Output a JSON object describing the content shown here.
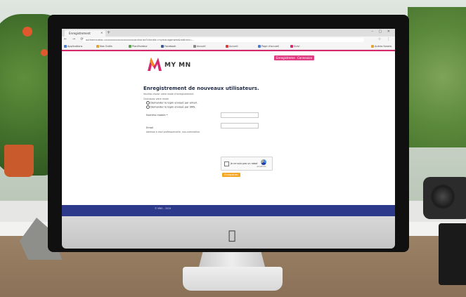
{
  "browser": {
    "tab_title": "Enregistrement",
    "url": "authentication.xxxxxxxxxxxxxxxxxxxx/authorize?clientId=mymanagerweb&redirect=...",
    "bookmarks": [
      {
        "label": "Applications",
        "color": "#4a7bd0"
      },
      {
        "label": "Nos Outils",
        "color": "#e0a33a"
      },
      {
        "label": "Planificateur",
        "color": "#59a14f"
      },
      {
        "label": "Facebook",
        "color": "#3b5998"
      },
      {
        "label": "Accueil",
        "color": "#888888"
      },
      {
        "label": "Accueil",
        "color": "#d93a3a"
      },
      {
        "label": "Page d'accueil",
        "color": "#4a7bd0"
      },
      {
        "label": "Suivi",
        "color": "#d6266d"
      },
      {
        "label": "Autres favoris",
        "color": "#e0a33a"
      }
    ]
  },
  "header": {
    "logo_text": "MY MN",
    "btn_register": "Enregistrement",
    "btn_login": "Connexion"
  },
  "form": {
    "title": "Enregistrement de nouveaux utilisateurs.",
    "subtitle": "Veuillez choisir votre mode d'enregistrement.",
    "choose_label": "Choisissez votre mode",
    "option_email": "Demander le login envoyé par email.",
    "option_sms": "Demander le login envoyé par SMS.",
    "phone_label": "Numéro mobile *",
    "email_label": "Email",
    "email_help": "Adresse e-mail professionnelle, non-nominative.",
    "captcha_label": "Je ne suis pas un robot",
    "captcha_brand": "reCAPTCHA",
    "submit_label": "Enregistrer"
  },
  "footer": {
    "text": "© MNS – 2019"
  }
}
